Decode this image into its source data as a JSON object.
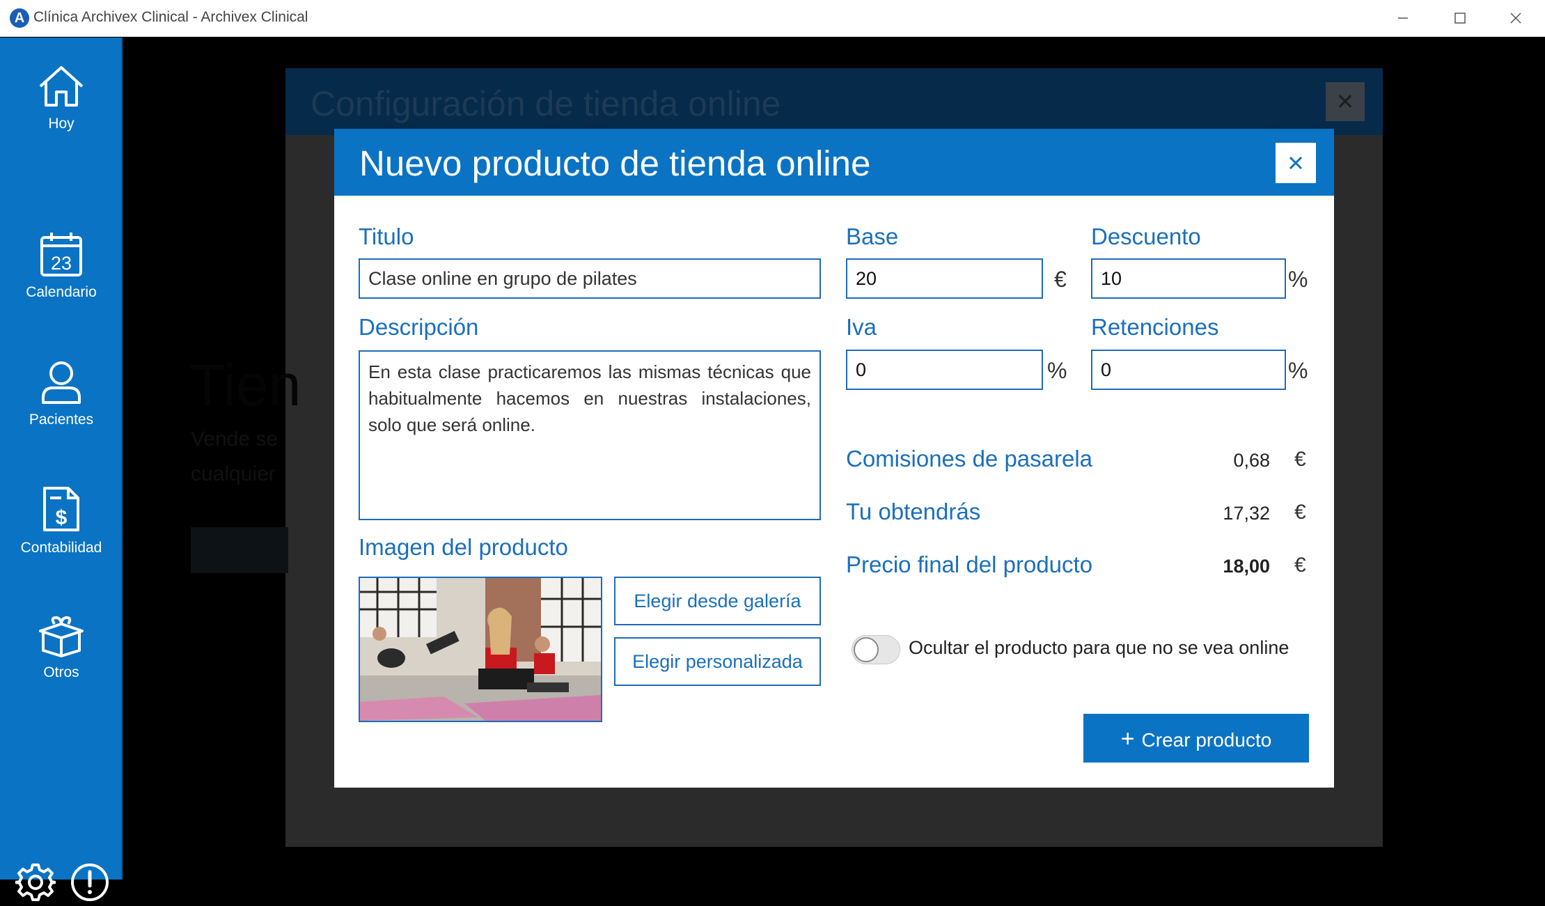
{
  "window": {
    "title": "Clínica Archivex Clinical - Archivex Clinical",
    "logo_letter": "A"
  },
  "sidebar": {
    "items": [
      {
        "label": "Hoy",
        "icon": "home-icon"
      },
      {
        "label": "Calendario",
        "icon": "calendar-icon",
        "day": "23"
      },
      {
        "label": "Pacientes",
        "icon": "user-icon"
      },
      {
        "label": "Contabilidad",
        "icon": "invoice-icon"
      },
      {
        "label": "Otros",
        "icon": "gift-box-icon"
      }
    ],
    "bottom": [
      {
        "icon": "gear-icon"
      },
      {
        "icon": "info-alert-icon"
      }
    ]
  },
  "background": {
    "dialog_title": "Configuración de tienda online",
    "page_heading_partial": "Tien",
    "line1_partial": "Vende se",
    "line2_partial": "cualquier"
  },
  "modal": {
    "title": "Nuevo producto de tienda online",
    "fields": {
      "titulo_label": "Titulo",
      "titulo_value": "Clase online en grupo de pilates",
      "descripcion_label": "Descripción",
      "descripcion_value": "En esta clase practicaremos las mismas técnicas que habitualmente hacemos en nuestras instalaciones, solo que será online.",
      "base_label": "Base",
      "base_value": "20",
      "base_unit": "€",
      "descuento_label": "Descuento",
      "descuento_value": "10",
      "descuento_unit": "%",
      "iva_label": "Iva",
      "iva_value": "0",
      "iva_unit": "%",
      "retenciones_label": "Retenciones",
      "retenciones_value": "0",
      "retenciones_unit": "%"
    },
    "image_label": "Imagen del producto",
    "buttons": {
      "gallery": "Elegir desde galería",
      "custom": "Elegir personalizada",
      "create_plus": "+",
      "create": "Crear producto"
    },
    "summary": [
      {
        "label": "Comisiones de pasarela",
        "value": "0,68",
        "currency": "€"
      },
      {
        "label": "Tu obtendrás",
        "value": "17,32",
        "currency": "€"
      },
      {
        "label": "Precio final del producto",
        "value": "18,00",
        "currency": "€"
      }
    ],
    "toggle": {
      "label": "Ocultar el producto para que no se vea online",
      "on": false
    }
  },
  "colors": {
    "accent": "#0a73c4",
    "label_blue": "#1b6fbd"
  }
}
